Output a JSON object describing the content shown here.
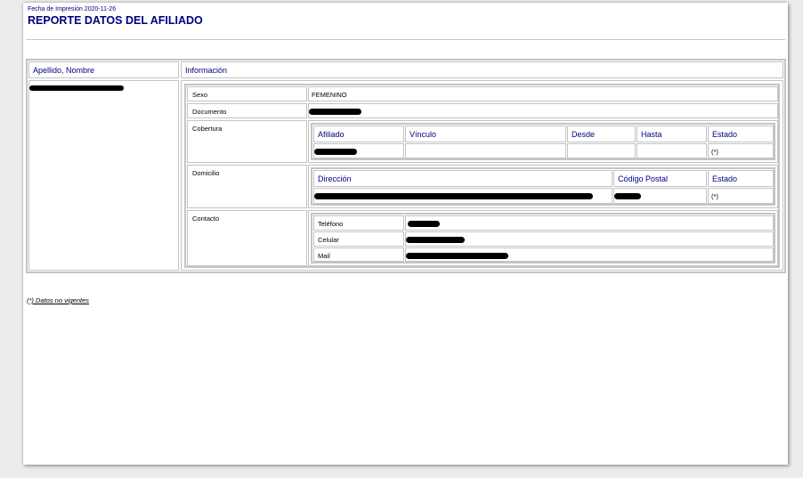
{
  "header": {
    "print_date": "Fecha de Impresión 2020-11-26",
    "title": "REPORTE DATOS DEL AFILIADO"
  },
  "columns": {
    "name": "Apellido, Nombre",
    "info": "Información"
  },
  "info": {
    "sexo_label": "Sexo",
    "sexo_value": "FEMENINO",
    "documento_label": "Documento",
    "cobertura_label": "Cobertura",
    "domicilio_label": "Domicilio",
    "contacto_label": "Contacto"
  },
  "cobertura": {
    "headers": [
      "Afiliado",
      "Vínculo",
      "Desde",
      "Hasta",
      "Estado"
    ],
    "row_estado": "(*)"
  },
  "domicilio": {
    "headers": [
      "Dirección",
      "Código Postal",
      "Estado"
    ],
    "row_estado": "(*)"
  },
  "contacto": {
    "telefono_label": "Teléfono",
    "celular_label": "Celular",
    "mail_label": "Mail"
  },
  "footnote": "(*) Datos no vigentes"
}
